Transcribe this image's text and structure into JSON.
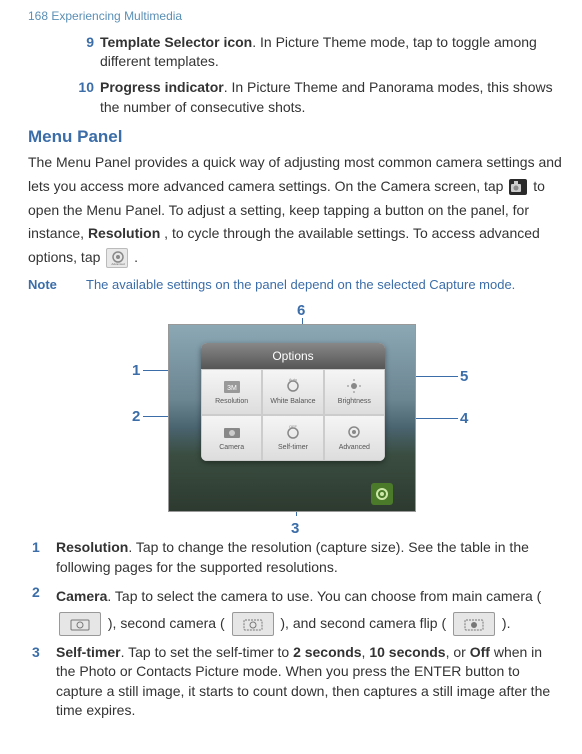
{
  "page_header": "168  Experiencing Multimedia",
  "item9": {
    "num": "9",
    "title": "Template Selector icon",
    "text": ". In Picture Theme mode, tap to toggle among different templates."
  },
  "item10": {
    "num": "10",
    "title": "Progress indicator",
    "text": ". In Picture Theme and Panorama modes, this shows the number of consecutive shots."
  },
  "menu_panel": {
    "title": "Menu Panel",
    "para_a": "The Menu Panel provides a quick way of adjusting most common camera settings and lets you access more advanced camera settings. On the Camera screen, tap ",
    "para_b": " to open the Menu Panel. To adjust a setting, keep tapping a button on the panel, for instance, ",
    "res_word": "Resolution",
    "para_c": ", to cycle through the available settings. To access advanced options, tap ",
    "para_d": "."
  },
  "note": {
    "label": "Note",
    "text": "The available settings on the panel depend on the selected Capture mode."
  },
  "callouts": {
    "c1": "1",
    "c2": "2",
    "c3": "3",
    "c4": "4",
    "c5": "5",
    "c6": "6"
  },
  "options": {
    "header": "Options",
    "cells": [
      "Resolution",
      "White Balance",
      "Brightness",
      "Camera",
      "Self-timer",
      "Advanced"
    ]
  },
  "list": {
    "i1": {
      "num": "1",
      "title": "Resolution",
      "text": ". Tap to change the resolution (capture size). See the table in the following pages for the supported resolutions."
    },
    "i2": {
      "num": "2",
      "title": "Camera",
      "text_a": ". Tap to select the camera to use. You can choose from main camera ( ",
      "text_b": " ), second camera ( ",
      "text_c": " ), and second camera flip ( ",
      "text_d": " )."
    },
    "i3": {
      "num": "3",
      "title": "Self-timer",
      "text_a": ". Tap to set the self-timer to ",
      "b1": "2 seconds",
      "text_b": ", ",
      "b2": "10 seconds",
      "text_c": ", or ",
      "b3": "Off",
      "text_d": " when in the Photo or Contacts Picture mode. When you press the ENTER button to capture a still image, it starts to count down, then captures a still image after the time expires."
    }
  }
}
